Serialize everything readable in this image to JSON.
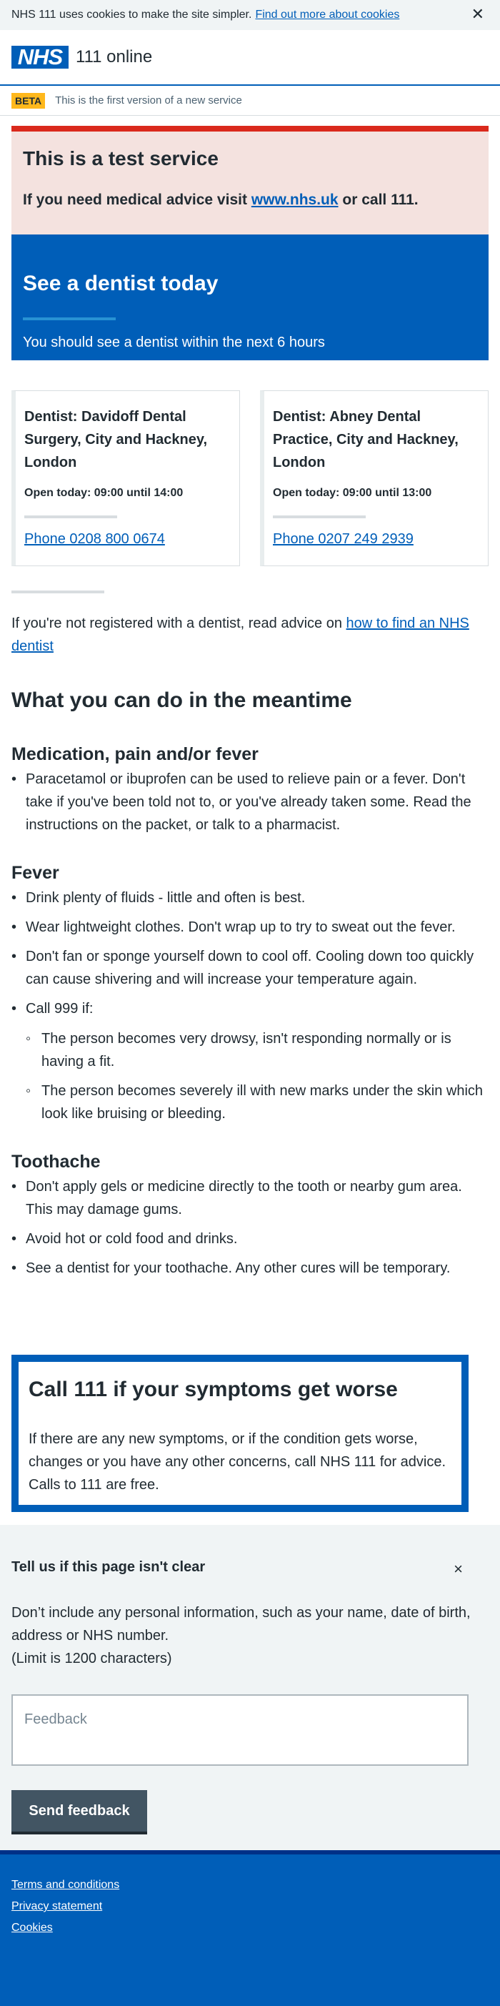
{
  "cookie_banner": {
    "text": "NHS 111 uses cookies to make the site simpler.",
    "link": "Find out more about cookies",
    "close": "✕"
  },
  "header": {
    "logo": "NHS",
    "service_name": "111 online"
  },
  "beta": {
    "tag": "BETA",
    "text": "This is the first version of a new service"
  },
  "test_notice": {
    "heading": "This is a test service",
    "text_before": "If you need medical advice visit",
    "link": "www.nhs.uk",
    "text_after": "or call 111."
  },
  "hero": {
    "title": "See a dentist today",
    "subtitle": "You should see a dentist within the next 6 hours"
  },
  "services": [
    {
      "name": "Dentist: Davidoff Dental Surgery, City and Hackney, London",
      "hours": "Open today: 09:00 until 14:00",
      "phone": "Phone 0208 800 0674"
    },
    {
      "name": "Dentist: Abney Dental Practice, City and Hackney, London",
      "hours": "Open today: 09:00 until 13:00",
      "phone": "Phone 0207 249 2939"
    }
  ],
  "registration": {
    "text": "If you're not registered with a dentist, read advice on",
    "link": "how to find an NHS dentist"
  },
  "meantime": {
    "heading": "What you can do in the meantime",
    "medication": {
      "heading": "Medication, pain and/or fever",
      "items": [
        "Paracetamol or ibuprofen can be used to relieve pain or a fever. Don't take if you've been told not to, or you've already taken some. Read the instructions on the packet, or talk to a pharmacist."
      ]
    },
    "fever": {
      "heading": "Fever",
      "items": [
        "Drink plenty of fluids - little and often is best.",
        "Wear lightweight clothes. Don't wrap up to try to sweat out the fever.",
        "Don't fan or sponge yourself down to cool off. Cooling down too quickly can cause shivering and will increase your temperature again.",
        "Call 999 if:"
      ],
      "call_999": [
        "The person becomes very drowsy, isn't responding normally or is having a fit.",
        "The person becomes severely ill with new marks under the skin which look like bruising or bleeding."
      ]
    },
    "toothache": {
      "heading": "Toothache",
      "items": [
        "Don't apply gels or medicine directly to the tooth or nearby gum area. This may damage gums.",
        "Avoid hot or cold food and drinks.",
        "See a dentist for your toothache. Any other cures will be temporary."
      ]
    }
  },
  "callout": {
    "heading": "Call 111 if your symptoms get worse",
    "text": "If there are any new symptoms, or if the condition gets worse, changes or you have any other concerns, call NHS 111 for advice. Calls to 111 are free."
  },
  "feedback": {
    "heading": "Tell us if this page isn't clear",
    "close": "×",
    "info": "Don’t include any personal information, such as your name, date of birth, address or NHS number.",
    "limit": "(Limit is 1200 characters)",
    "placeholder": "Feedback",
    "button": "Send feedback"
  },
  "footer": {
    "links": [
      "Terms and conditions",
      "Privacy statement",
      "Cookies"
    ]
  },
  "colors": {
    "nhs_blue": "#005eb8",
    "nhs_dark_blue": "#003087",
    "warning_red": "#da291c",
    "beta_yellow": "#ffb81c",
    "grey_bg": "#f0f4f5"
  }
}
